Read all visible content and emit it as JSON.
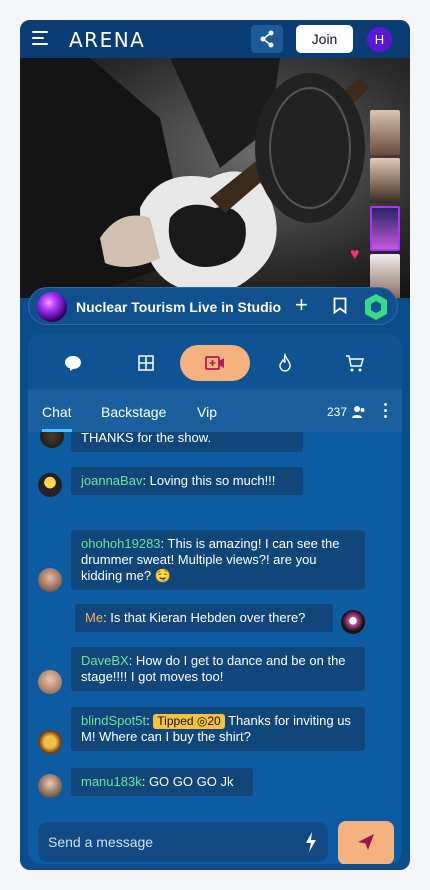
{
  "app": {
    "logo": "ARENA",
    "join_label": "Join",
    "avatar_initial": "H"
  },
  "stream": {
    "title": "Nuclear Tourism Live in Studio"
  },
  "tabs": [
    "chat-icon",
    "layout-icon",
    "video-icon",
    "flame-icon",
    "cart-icon"
  ],
  "subtabs": {
    "chat": "Chat",
    "backstage": "Backstage",
    "vip": "Vip",
    "viewer_count": "237"
  },
  "messages": [
    {
      "user": "",
      "text": "THANKS for the show."
    },
    {
      "user": "joannaBav",
      "text": ": Loving this so much!!!"
    },
    {
      "user": "ohohoh19283",
      "text": ": This is amazing! I can see the drummer sweat! Multiple views?! are you kidding me? 🤤"
    },
    {
      "user": "Me",
      "text": ": Is that Kieran Hebden over there?"
    },
    {
      "user": "DaveBX",
      "text": ": How do I get to dance and be on the stage!!!! I got moves too!"
    },
    {
      "user": "blindSpot5t",
      "tip_label": "Tipped",
      "tip_amount": "◎20",
      "text": " Thanks for inviting us M! Where can I buy the shirt?"
    },
    {
      "user": "manu183k",
      "text": ": GO GO GO Jk"
    }
  ],
  "composer": {
    "placeholder": "Send a message"
  },
  "colors": {
    "accent": "#f5b27f",
    "username": "#6fe29a",
    "me": "#f7b05a",
    "tip": "#f6c23b",
    "brand_bg": "#0b4d8c"
  }
}
